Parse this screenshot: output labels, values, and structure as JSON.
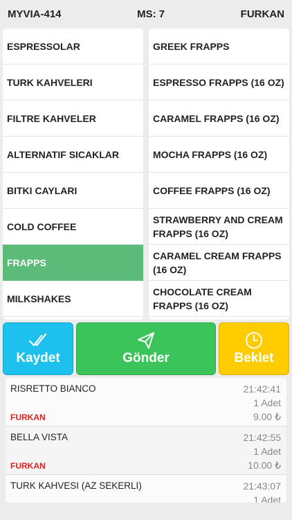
{
  "header": {
    "table": "MYVIA-414",
    "ms": "MS: 7",
    "user": "FURKAN"
  },
  "categories": [
    {
      "label": "ESPRESSOLAR",
      "selected": false
    },
    {
      "label": "TURK KAHVELERI",
      "selected": false
    },
    {
      "label": "FILTRE KAHVELER",
      "selected": false
    },
    {
      "label": "ALTERNATIF SICAKLAR",
      "selected": false
    },
    {
      "label": "BITKI CAYLARI",
      "selected": false
    },
    {
      "label": "COLD COFFEE",
      "selected": false
    },
    {
      "label": "FRAPPS",
      "selected": true
    },
    {
      "label": "MILKSHAKES",
      "selected": false
    }
  ],
  "products": [
    {
      "label": "GREEK FRAPPS"
    },
    {
      "label": "ESPRESSO FRAPPS (16 OZ)"
    },
    {
      "label": "CARAMEL FRAPPS (16 OZ)"
    },
    {
      "label": "MOCHA FRAPPS (16 OZ)"
    },
    {
      "label": "COFFEE FRAPPS (16 OZ)"
    },
    {
      "label": "STRAWBERRY AND CREAM FRAPPS (16 OZ)"
    },
    {
      "label": "CARAMEL CREAM FRAPPS (16 OZ)"
    },
    {
      "label": "CHOCOLATE CREAM FRAPPS (16 OZ)"
    }
  ],
  "actions": {
    "save": {
      "label": "Kaydet",
      "icon": "double-check-icon",
      "color": "#1ec1ee"
    },
    "send": {
      "label": "Gönder",
      "icon": "paper-plane-icon",
      "color": "#3bc45a"
    },
    "wait": {
      "label": "Beklet",
      "icon": "clock-icon",
      "color": "#ffcc00"
    }
  },
  "orders": [
    {
      "name": "RISRETTO BIANCO",
      "time": "21:42:41",
      "qty": "1 Adet",
      "user": "FURKAN",
      "price": "9.00 ₺"
    },
    {
      "name": "BELLA VISTA",
      "time": "21:42:55",
      "qty": "1 Adet",
      "user": "FURKAN",
      "price": "10.00 ₺"
    },
    {
      "name": "TURK KAHVESI (AZ SEKERLI)",
      "time": "21:43:07",
      "qty": "1 Adet",
      "user": "",
      "price": ""
    }
  ],
  "colors": {
    "selected": "#5dbb7a",
    "user_red": "#e02020"
  }
}
